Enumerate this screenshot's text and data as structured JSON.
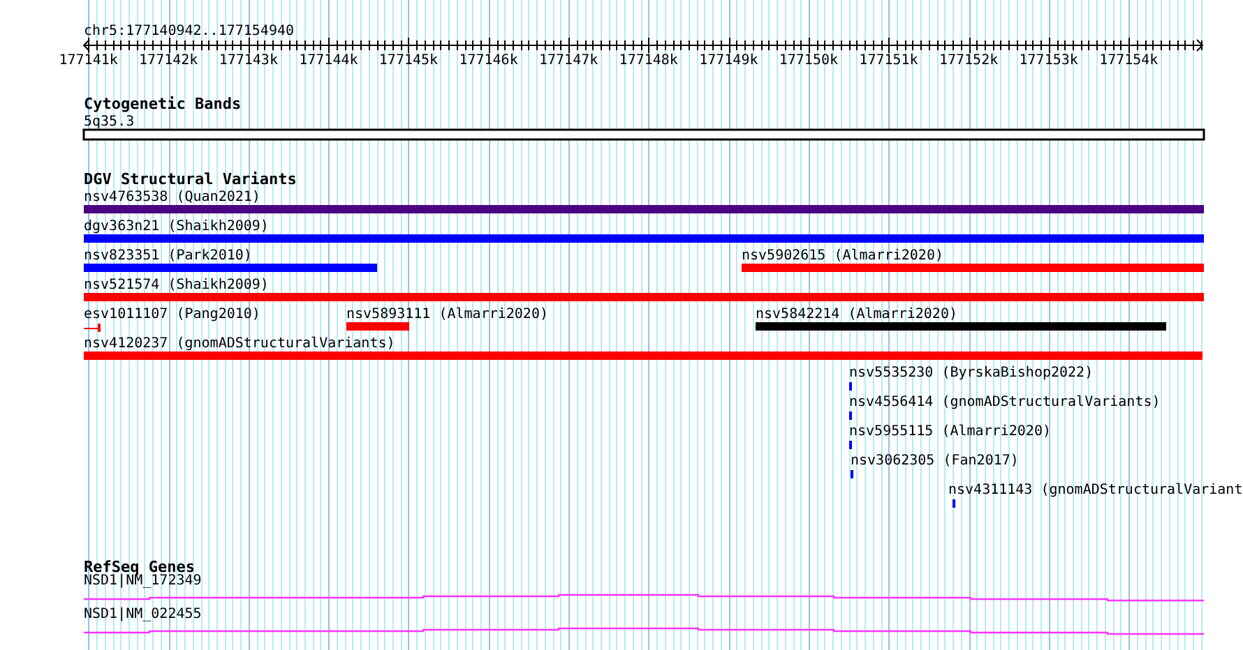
{
  "location": "chr5:177140942..177154940",
  "ruler": {
    "ticks": [
      "177141k",
      "177142k",
      "177143k",
      "177144k",
      "177145k",
      "177146k",
      "177147k",
      "177148k",
      "177149k",
      "177150k",
      "177151k",
      "177152k",
      "177153k",
      "177154k"
    ]
  },
  "tracks": [
    {
      "kind": "bands",
      "title": "Cytogenetic Bands",
      "features": [
        {
          "label": "5q35.3"
        }
      ]
    },
    {
      "kind": "variants",
      "title": "DGV Structural Variants",
      "features": [
        {
          "label": "nsv4763538 (Quan2021)",
          "color": "#4b0082"
        },
        {
          "label": "dgv363n21 (Shaikh2009)",
          "color": "#0000ff"
        },
        {
          "label": "nsv823351 (Park2010)",
          "color": "#0000ff"
        },
        {
          "label": "nsv5902615 (Almarri2020)",
          "color": "#ff0000"
        },
        {
          "label": "nsv521574 (Shaikh2009)",
          "color": "#ff0000"
        },
        {
          "label": "esv1011107 (Pang2010)",
          "color": "#ff0000"
        },
        {
          "label": "nsv5893111 (Almarri2020)",
          "color": "#ff0000"
        },
        {
          "label": "nsv5842214 (Almarri2020)",
          "color": "#000000"
        },
        {
          "label": "nsv4120237 (gnomADStructuralVariants)",
          "color": "#ff0000"
        },
        {
          "label": "nsv5535230 (ByrskaBishop2022)",
          "color": "#0000ff"
        },
        {
          "label": "nsv4556414 (gnomADStructuralVariants)",
          "color": "#0000ff"
        },
        {
          "label": "nsv5955115 (Almarri2020)",
          "color": "#0000ff"
        },
        {
          "label": "nsv3062305 (Fan2017)",
          "color": "#0000ff"
        },
        {
          "label": "nsv4311143 (gnomADStructuralVariant",
          "color": "#0000ff"
        }
      ]
    },
    {
      "kind": "genes",
      "title": "RefSeq Genes",
      "features": [
        {
          "label": "NSD1|NM_172349"
        },
        {
          "label": "NSD1|NM_022455"
        }
      ]
    }
  ]
}
